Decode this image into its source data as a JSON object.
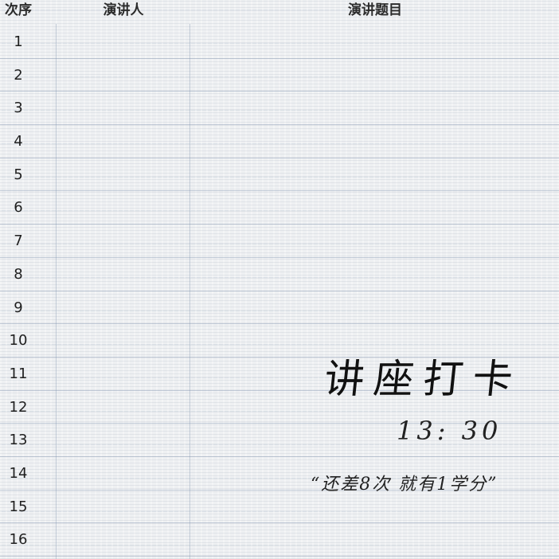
{
  "header": {
    "order": "次序",
    "speaker": "演讲人",
    "topic": "演讲题目"
  },
  "rows": [
    {
      "num": "1"
    },
    {
      "num": "2"
    },
    {
      "num": "3"
    },
    {
      "num": "4"
    },
    {
      "num": "5"
    },
    {
      "num": "6"
    },
    {
      "num": "7"
    },
    {
      "num": "8"
    },
    {
      "num": "9"
    },
    {
      "num": "10"
    },
    {
      "num": "11"
    },
    {
      "num": "12"
    },
    {
      "num": "13"
    },
    {
      "num": "14"
    },
    {
      "num": "15"
    },
    {
      "num": "16"
    }
  ],
  "overlay": {
    "title": "讲座打卡",
    "time": "13: 30",
    "note": "“还差8次 就有1学分”"
  }
}
